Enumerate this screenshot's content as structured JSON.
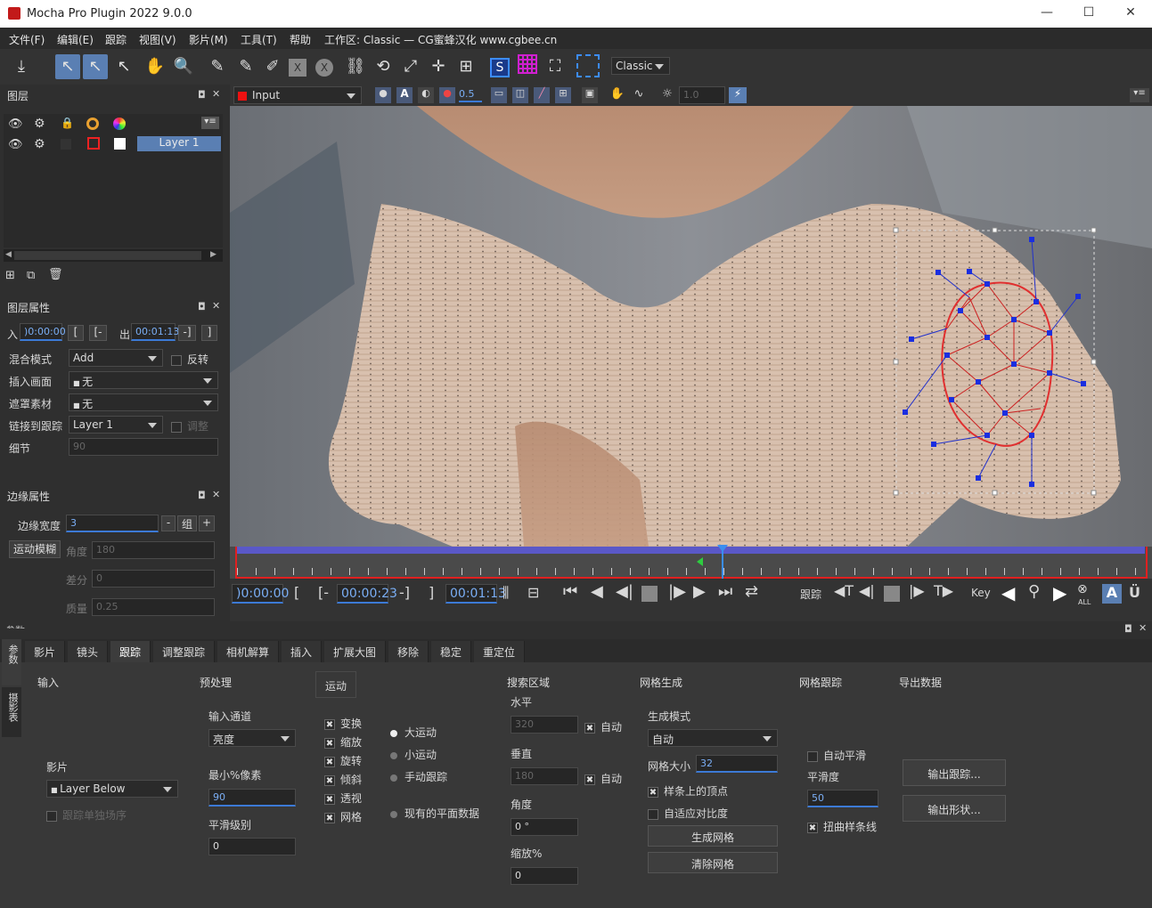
{
  "window": {
    "title": "Mocha Pro Plugin 2022 9.0.0"
  },
  "menu": [
    "文件(F)",
    "编辑(E)",
    "跟踪",
    "视图(V)",
    "影片(M)",
    "工具(T)",
    "帮助",
    "工作区: Classic — CG蜜蜂汉化 www.cgbee.cn"
  ],
  "toolbar": {
    "workspace": "Classic"
  },
  "layers_panel": {
    "title": "图层",
    "layer_name": "Layer 1"
  },
  "layer_props": {
    "title": "图层属性",
    "in_label": "入",
    "in_value": ")0:00:00",
    "out_label": "出",
    "out_value": "00:01:13",
    "blend_label": "混合模式",
    "blend_value": "Add",
    "invert_label": "反转",
    "insert_label": "插入画面",
    "insert_value": "无",
    "matte_label": "遮罩素材",
    "matte_value": "无",
    "link_label": "链接到跟踪",
    "link_value": "Layer 1",
    "adjust_label": "调整",
    "detail_label": "细节",
    "detail_value": "90"
  },
  "edge_props": {
    "title": "边缘属性",
    "width_label": "边缘宽度",
    "width_value": "3",
    "group_label": "组",
    "motion_blur": "运动模糊",
    "angle_label": "角度",
    "angle_value": "180",
    "phase_label": "差分",
    "phase_value": "0",
    "quality_label": "质量",
    "quality_value": "0.25"
  },
  "viewer_tb": {
    "layer_select": "Input",
    "opacity": "0.5",
    "gamma": "1.0"
  },
  "transport": {
    "cur_time": ")0:00:00",
    "in_time": "00:00:23",
    "out_time": "00:01:13",
    "track_label": "跟踪",
    "key_label": "Key",
    "all_label": "ALL"
  },
  "params": {
    "title": "参数",
    "side_tab_1": "参数",
    "side_tab_2": "摄影表",
    "tabs": [
      "影片",
      "镜头",
      "跟踪",
      "调整跟踪",
      "相机解算",
      "插入",
      "扩展大图",
      "移除",
      "稳定",
      "重定位"
    ],
    "input": {
      "label": "输入",
      "clip_label": "影片",
      "clip_value": "Layer Below",
      "track_individual": "跟踪单独场序"
    },
    "preprocess": {
      "label": "预处理",
      "channel_label": "输入通道",
      "channel_value": "亮度",
      "min_pixels_label": "最小%像素",
      "min_pixels_value": "90",
      "smooth_label": "平滑级别",
      "smooth_value": "0"
    },
    "motion": {
      "label": "运动",
      "items": [
        "变换",
        "缩放",
        "旋转",
        "倾斜",
        "透视",
        "网格"
      ],
      "large": "大运动",
      "small": "小运动",
      "manual": "手动跟踪",
      "existing": "现有的平面数据"
    },
    "search": {
      "label": "搜索区域",
      "horizontal": "水平",
      "h_value": "320",
      "auto1": "自动",
      "vertical": "垂直",
      "v_value": "180",
      "auto2": "自动",
      "angle": "角度",
      "angle_value": "0 °",
      "zoom": "缩放%",
      "zoom_value": "0"
    },
    "mesh_gen": {
      "label": "网格生成",
      "mode_label": "生成模式",
      "mode_value": "自动",
      "size_label": "网格大小",
      "size_value": "32",
      "spline_vertices": "样条上的顶点",
      "adaptive": "自适应对比度",
      "generate": "生成网格",
      "clear": "清除网格"
    },
    "mesh_track": {
      "label": "网格跟踪",
      "auto_smooth": "自动平滑",
      "smooth_label": "平滑度",
      "smooth_value": "50",
      "warp_spline": "扭曲样条线"
    },
    "export": {
      "label": "导出数据",
      "export_track": "输出跟踪...",
      "export_shape": "输出形状..."
    }
  }
}
